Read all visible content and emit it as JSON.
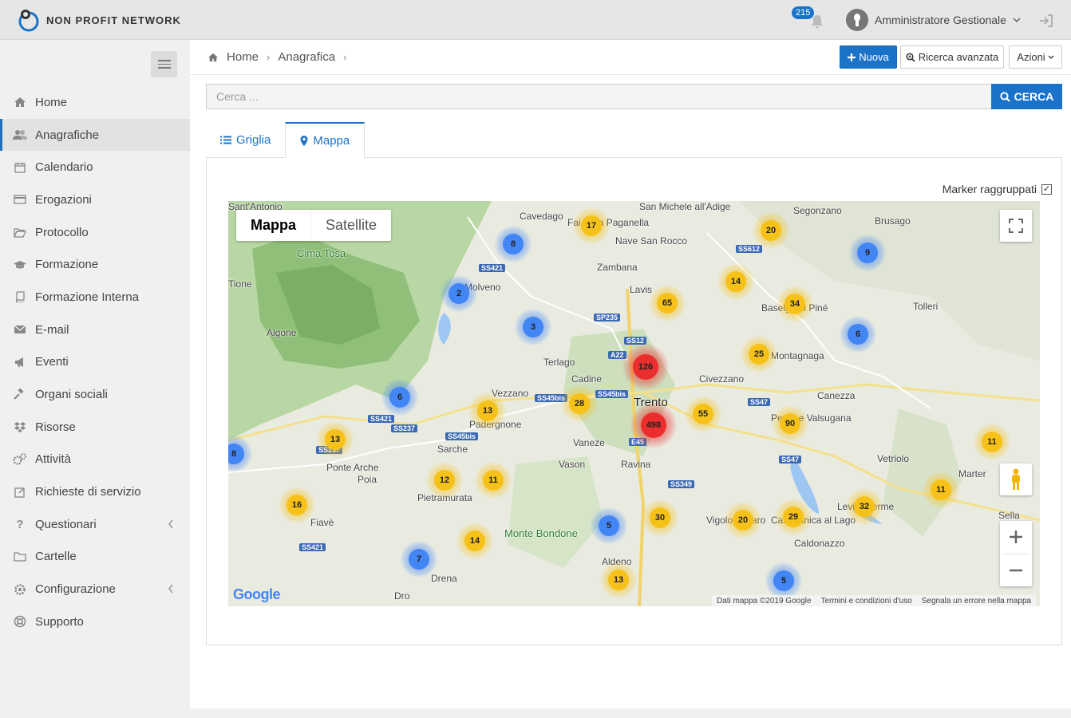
{
  "app": {
    "brand": "NON PROFIT NETWORK",
    "notifications": "215",
    "user": "Amministratore Gestionale"
  },
  "sidebar": {
    "items": [
      {
        "label": "Home",
        "icon": "home-icon"
      },
      {
        "label": "Anagrafiche",
        "icon": "users-icon"
      },
      {
        "label": "Calendario",
        "icon": "calendar-icon"
      },
      {
        "label": "Erogazioni",
        "icon": "card-icon"
      },
      {
        "label": "Protocollo",
        "icon": "folder-open-icon"
      },
      {
        "label": "Formazione",
        "icon": "graduation-cap-icon"
      },
      {
        "label": "Formazione Interna",
        "icon": "book-icon"
      },
      {
        "label": "E-mail",
        "icon": "envelope-icon"
      },
      {
        "label": "Eventi",
        "icon": "bullhorn-icon"
      },
      {
        "label": "Organi sociali",
        "icon": "gavel-icon"
      },
      {
        "label": "Risorse",
        "icon": "dropbox-icon"
      },
      {
        "label": "Attività",
        "icon": "cogs-icon"
      },
      {
        "label": "Richieste di servizio",
        "icon": "edit-icon"
      },
      {
        "label": "Questionari",
        "icon": "question-icon"
      },
      {
        "label": "Cartelle",
        "icon": "folder-icon"
      },
      {
        "label": "Configurazione",
        "icon": "gear-icon"
      },
      {
        "label": "Supporto",
        "icon": "life-ring-icon"
      }
    ]
  },
  "breadcrumb": {
    "home": "Home",
    "current": "Anagrafica"
  },
  "toolbar": {
    "new": "Nuova",
    "advanced_search": "Ricerca avanzata",
    "actions": "Azioni"
  },
  "search": {
    "placeholder": "Cerca ...",
    "button": "CERCA"
  },
  "tabs": {
    "grid": "Griglia",
    "map": "Mappa"
  },
  "map": {
    "cluster_toggle": "Marker raggruppati",
    "type_map": "Mappa",
    "type_satellite": "Satellite",
    "google": "Google",
    "footer": {
      "data": "Dati mappa ©2019 Google",
      "terms": "Termini e condizioni d'uso",
      "report": "Segnala un errore nella mappa"
    },
    "places": [
      "Sant'Antonio",
      "Cavedago",
      "Fai della Paganella",
      "San Michele all'Adige",
      "Segonzano",
      "Brusago",
      "Cima Tosa",
      "Nave San Rocco",
      "Zambana",
      "Lavis",
      "Tolleri",
      "Algone",
      "Terlago",
      "Cadine",
      "Trento",
      "Civezzano",
      "Canezza",
      "Vezzano",
      "Padergnone",
      "Sarche",
      "Vaneze",
      "Vason",
      "Ravina",
      "Pergine Valsugana",
      "Vetriolo",
      "Marter",
      "Ponte Arche",
      "Poia",
      "Pietramurata",
      "Fiavè",
      "Monte Bondone",
      "Aldeno",
      "Drena",
      "Dro",
      "Vigolo Vattaro",
      "Calceranica al Lago",
      "Caldonazzo",
      "Levico Terme",
      "Sella",
      "Baselga di Piné",
      "Montagnaga",
      "Molveno",
      "Tione"
    ],
    "clusters": [
      {
        "count": "17",
        "color": "yellow"
      },
      {
        "count": "8",
        "color": "blue"
      },
      {
        "count": "20",
        "color": "yellow"
      },
      {
        "count": "9",
        "color": "blue"
      },
      {
        "count": "14",
        "color": "yellow"
      },
      {
        "count": "2",
        "color": "blue"
      },
      {
        "count": "65",
        "color": "yellow"
      },
      {
        "count": "34",
        "color": "yellow"
      },
      {
        "count": "3",
        "color": "blue"
      },
      {
        "count": "6",
        "color": "blue"
      },
      {
        "count": "25",
        "color": "yellow"
      },
      {
        "count": "126",
        "color": "red"
      },
      {
        "count": "6",
        "color": "blue"
      },
      {
        "count": "28",
        "color": "yellow"
      },
      {
        "count": "13",
        "color": "yellow"
      },
      {
        "count": "55",
        "color": "yellow"
      },
      {
        "count": "498",
        "color": "red"
      },
      {
        "count": "90",
        "color": "yellow"
      },
      {
        "count": "13",
        "color": "yellow"
      },
      {
        "count": "8",
        "color": "blue"
      },
      {
        "count": "11",
        "color": "yellow"
      },
      {
        "count": "12",
        "color": "yellow"
      },
      {
        "count": "11",
        "color": "yellow"
      },
      {
        "count": "16",
        "color": "yellow"
      },
      {
        "count": "11",
        "color": "yellow"
      },
      {
        "count": "32",
        "color": "yellow"
      },
      {
        "count": "5",
        "color": "blue"
      },
      {
        "count": "30",
        "color": "yellow"
      },
      {
        "count": "20",
        "color": "yellow"
      },
      {
        "count": "29",
        "color": "yellow"
      },
      {
        "count": "14",
        "color": "yellow"
      },
      {
        "count": "7",
        "color": "blue"
      },
      {
        "count": "13",
        "color": "yellow"
      },
      {
        "count": "5",
        "color": "blue"
      }
    ],
    "roads": [
      "SS421",
      "SS612",
      "SP235",
      "SS12",
      "A22",
      "SS45bis",
      "SS45bis",
      "SS47",
      "SS421",
      "SS237",
      "SS45bis",
      "E45",
      "SS237",
      "SS47",
      "SS349",
      "SS421"
    ]
  },
  "colors": {
    "primary": "#1a73c8",
    "red_cluster": "#ea2e2e",
    "yellow_cluster": "#f6c21a",
    "blue_cluster": "#4285f4"
  }
}
